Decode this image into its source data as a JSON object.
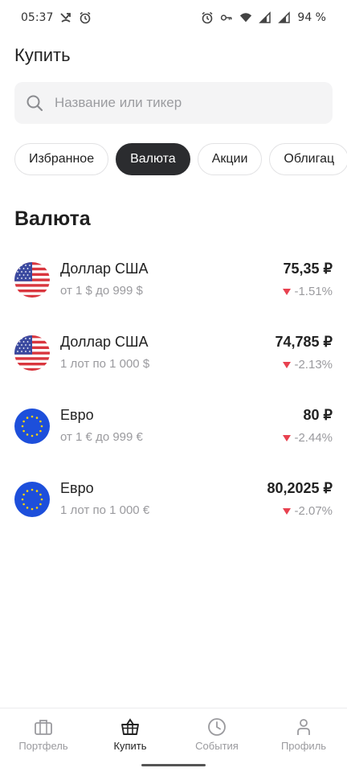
{
  "status": {
    "time": "05:37",
    "battery": "94 %"
  },
  "page": {
    "title": "Купить"
  },
  "search": {
    "placeholder": "Название или тикер"
  },
  "chips": [
    {
      "label": "Избранное"
    },
    {
      "label": "Валюта"
    },
    {
      "label": "Акции"
    },
    {
      "label": "Облигац"
    }
  ],
  "section": {
    "title": "Валюта"
  },
  "items": [
    {
      "name": "Доллар США",
      "sub": "от 1 $ до 999 $",
      "price": "75,35 ₽",
      "change": "-1.51%",
      "flag": "us-flag-icon"
    },
    {
      "name": "Доллар США",
      "sub": "1 лот по 1 000 $",
      "price": "74,785 ₽",
      "change": "-2.13%",
      "flag": "us-flag-icon"
    },
    {
      "name": "Евро",
      "sub": "от 1 € до 999 €",
      "price": "80 ₽",
      "change": "-2.44%",
      "flag": "eu-flag-icon"
    },
    {
      "name": "Евро",
      "sub": "1 лот по 1 000 €",
      "price": "80,2025 ₽",
      "change": "-2.07%",
      "flag": "eu-flag-icon"
    }
  ],
  "tabs": [
    {
      "label": "Портфель",
      "icon": "briefcase-icon"
    },
    {
      "label": "Купить",
      "icon": "basket-icon"
    },
    {
      "label": "События",
      "icon": "clock-icon"
    },
    {
      "label": "Профиль",
      "icon": "person-icon"
    }
  ],
  "colors": {
    "accent_dark": "#2b2c2f",
    "negative": "#e8414f",
    "muted": "#9a9a9e"
  }
}
